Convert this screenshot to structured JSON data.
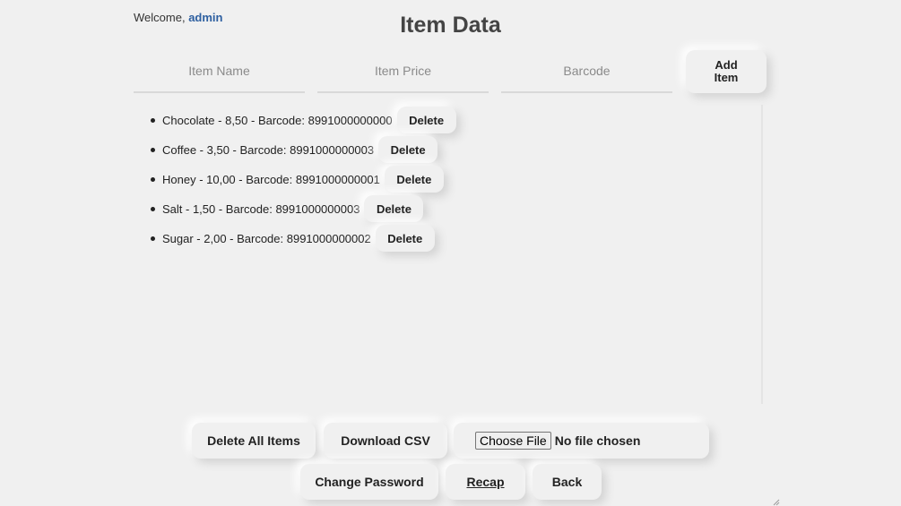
{
  "header": {
    "welcome_prefix": "Welcome,",
    "username": "admin",
    "title": "Item Data"
  },
  "form": {
    "name_placeholder": "Item Name",
    "price_placeholder": "Item Price",
    "barcode_placeholder": "Barcode",
    "add_label": "Add Item"
  },
  "items": [
    {
      "text": "Chocolate - 8,50 - Barcode: 8991000000000",
      "delete_label": "Delete"
    },
    {
      "text": "Coffee - 3,50 - Barcode: 8991000000003",
      "delete_label": "Delete"
    },
    {
      "text": "Honey - 10,00 - Barcode: 8991000000001",
      "delete_label": "Delete"
    },
    {
      "text": "Salt - 1,50 - Barcode: 8991000000003",
      "delete_label": "Delete"
    },
    {
      "text": "Sugar - 2,00 - Barcode: 8991000000002",
      "delete_label": "Delete"
    }
  ],
  "actions": {
    "delete_all": "Delete All Items",
    "download_csv": "Download CSV",
    "choose_file": "Choose File",
    "file_status": "No file chosen",
    "change_password": "Change Password",
    "recap": "Recap",
    "back": "Back"
  },
  "colors": {
    "background": "#f0f0f0",
    "username": "#2d5fa0",
    "title": "#444444"
  },
  "icons": {
    "resize": "resize-handle-icon"
  }
}
